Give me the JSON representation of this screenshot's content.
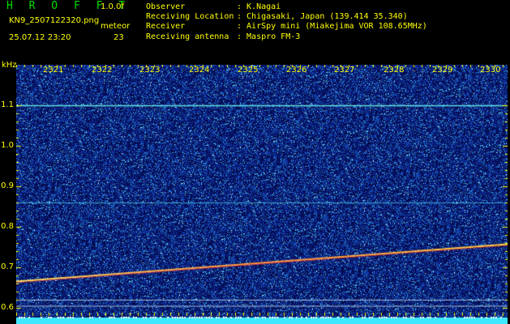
{
  "header": {
    "brand": "H R O F F T",
    "version": "1.0.0f",
    "filename": "KN9_2507122320.png",
    "meteor_label": "meteor",
    "datetime": "25.07.12 23:20",
    "meteor_count": "23"
  },
  "station": [
    {
      "label": "Observer",
      "value": ": K.Nagai"
    },
    {
      "label": "Receiving Location",
      "value": ": Chigasaki, Japan (139.414 35.340)"
    },
    {
      "label": "Receiver",
      "value": ": AirSpy mini (Miakejima VOR 108.65MHz)"
    },
    {
      "label": "Receiving antenna",
      "value": ": Maspro FM-3"
    }
  ],
  "spectrogram": {
    "y_unit": "kHz",
    "y_ticks": [
      "1.1",
      "1.0",
      "0.9",
      "0.8",
      "0.7",
      "0.6"
    ],
    "y_values": [
      1.1,
      1.0,
      0.9,
      0.8,
      0.7,
      0.6
    ],
    "x_ticks": [
      "2321",
      "2322",
      "2323",
      "2324",
      "2325",
      "2326",
      "2327",
      "2328",
      "2329",
      "2330"
    ],
    "background_color": "#0a1470",
    "trace": {
      "from_khz": 0.665,
      "to_khz": 0.757
    },
    "horizontal_lines_khz": [
      1.1,
      0.86,
      0.62,
      0.605
    ]
  }
}
